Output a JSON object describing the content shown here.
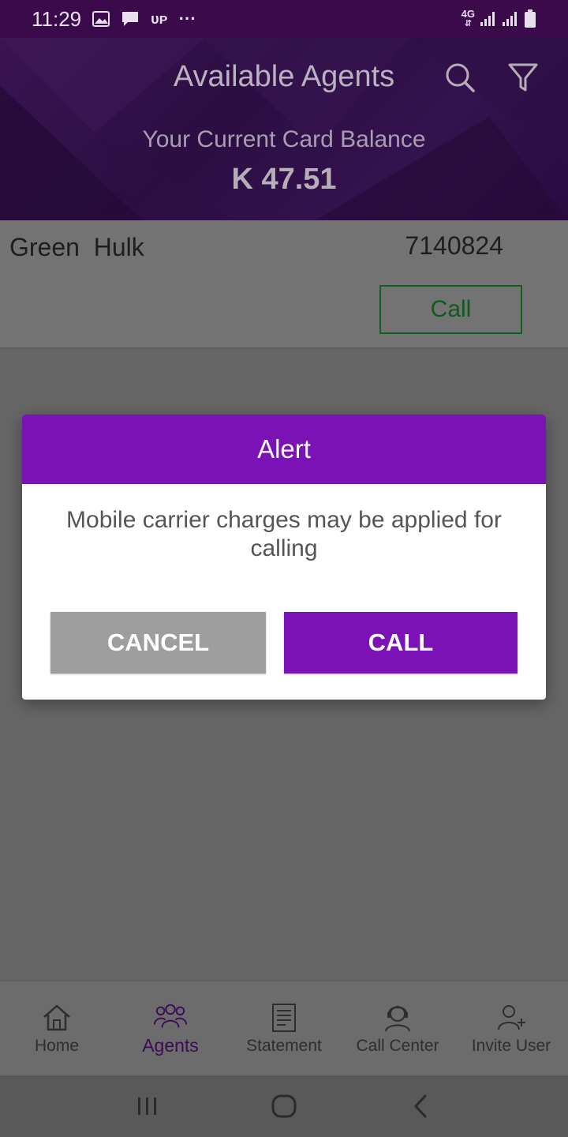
{
  "status_bar": {
    "time": "11:29",
    "network": "4G",
    "icons": [
      "image-icon",
      "message-icon",
      "app-icon",
      "more-icon",
      "network-4g-icon",
      "signal-icon",
      "signal-icon",
      "battery-icon"
    ],
    "app_icon_text": "ᴜᴘ",
    "more_icon_text": "···"
  },
  "header": {
    "title": "Available Agents",
    "balance_label": "Your Current Card Balance",
    "balance_value": "K 47.51",
    "icons": [
      "search-icon",
      "filter-icon"
    ]
  },
  "agents": [
    {
      "name": "Green  Hulk",
      "number": "7140824",
      "call_label": "Call"
    }
  ],
  "dialog": {
    "title": "Alert",
    "message": "Mobile carrier charges may be applied for calling",
    "cancel_label": "CANCEL",
    "call_label": "CALL"
  },
  "bottom_nav": {
    "items": [
      {
        "label": "Home",
        "icon": "home-icon",
        "active": false
      },
      {
        "label": "Agents",
        "icon": "agents-icon",
        "active": true
      },
      {
        "label": "Statement",
        "icon": "statement-icon",
        "active": false
      },
      {
        "label": "Call Center",
        "icon": "call-center-icon",
        "active": false
      },
      {
        "label": "Invite User",
        "icon": "invite-user-icon",
        "active": false
      }
    ]
  },
  "system_nav": {
    "icons": [
      "recents-icon",
      "home-button-icon",
      "back-icon"
    ]
  },
  "colors": {
    "primary": "#7a12b5",
    "status_bar": "#3a0a4a",
    "header": "#2e0d44",
    "call_outline": "#0f5f20",
    "cancel_gray": "#9e9e9e",
    "overlay_bg": "#666666"
  }
}
